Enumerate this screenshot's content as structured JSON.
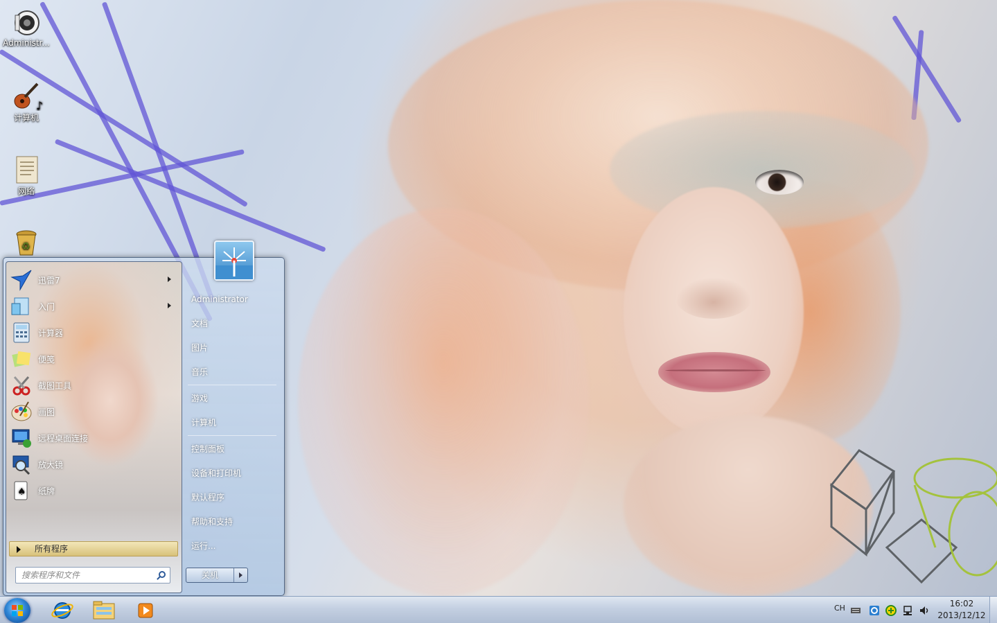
{
  "desktop": {
    "icons": [
      {
        "label": "Administr...",
        "icon": "speaker-icon"
      },
      {
        "label": "计算机",
        "icon": "guitar-icon"
      },
      {
        "label": "网络",
        "icon": "document-icon"
      },
      {
        "label": "",
        "icon": "recycle-bin-icon"
      }
    ]
  },
  "start_menu": {
    "programs": [
      {
        "label": "迅雷7",
        "icon": "thunder-bird-icon",
        "has_submenu": true
      },
      {
        "label": "入门",
        "icon": "getting-started-icon",
        "has_submenu": true
      },
      {
        "label": "计算器",
        "icon": "calculator-icon",
        "has_submenu": false
      },
      {
        "label": "便笺",
        "icon": "sticky-notes-icon",
        "has_submenu": false
      },
      {
        "label": "截图工具",
        "icon": "snipping-tool-icon",
        "has_submenu": false
      },
      {
        "label": "画图",
        "icon": "paint-icon",
        "has_submenu": false
      },
      {
        "label": "远程桌面连接",
        "icon": "remote-desktop-icon",
        "has_submenu": false
      },
      {
        "label": "放大镜",
        "icon": "magnifier-icon",
        "has_submenu": false
      },
      {
        "label": "纸牌",
        "icon": "solitaire-icon",
        "has_submenu": false
      }
    ],
    "all_programs_label": "所有程序",
    "search_placeholder": "搜索程序和文件",
    "right_items": [
      {
        "label": "Administrator"
      },
      {
        "label": "文档"
      },
      {
        "label": "图片"
      },
      {
        "label": "音乐"
      },
      {
        "label": "游戏"
      },
      {
        "label": "计算机"
      },
      {
        "label": "控制面板"
      },
      {
        "label": "设备和打印机"
      },
      {
        "label": "默认程序"
      },
      {
        "label": "帮助和支持"
      },
      {
        "label": "运行..."
      }
    ],
    "shutdown_label": "关机"
  },
  "taskbar": {
    "pinned": [
      {
        "name": "internet-explorer-icon"
      },
      {
        "name": "file-explorer-icon"
      },
      {
        "name": "media-player-icon"
      }
    ],
    "tray": {
      "language": "CH",
      "time": "16:02",
      "date": "2013/12/12"
    }
  }
}
